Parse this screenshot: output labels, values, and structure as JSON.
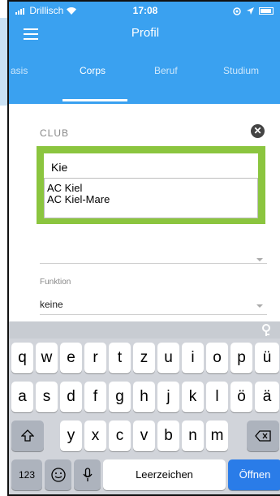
{
  "status_bar": {
    "carrier": "Drillisch",
    "time": "17:08",
    "right_icons": [
      "location-icon",
      "battery-icon"
    ]
  },
  "header": {
    "title": "Profil",
    "tabs": [
      {
        "label": "asis",
        "active": false
      },
      {
        "label": "Corps",
        "active": true
      },
      {
        "label": "Beruf",
        "active": false
      },
      {
        "label": "Studium",
        "active": false
      }
    ]
  },
  "club": {
    "label": "CLUB",
    "input_value": "Kie",
    "suggestions": [
      "AC Kiel",
      "AC Kiel-Mare"
    ]
  },
  "funktion": {
    "label": "Funktion",
    "value": "keine"
  },
  "keyboard": {
    "row1": [
      "q",
      "w",
      "e",
      "r",
      "t",
      "z",
      "u",
      "i",
      "o",
      "p",
      "ü"
    ],
    "row2": [
      "a",
      "s",
      "d",
      "f",
      "g",
      "h",
      "j",
      "k",
      "l",
      "ö",
      "ä"
    ],
    "row3": [
      "y",
      "x",
      "c",
      "v",
      "b",
      "n",
      "m"
    ],
    "numbers_key": "123",
    "space_label": "Leerzeichen",
    "go_label": "Öffnen"
  },
  "colors": {
    "header_blue": "#3aa1f0",
    "highlight_green": "#8bc53f",
    "go_key_blue": "#2a7ce8",
    "keyboard_bg": "#d1d4da"
  }
}
